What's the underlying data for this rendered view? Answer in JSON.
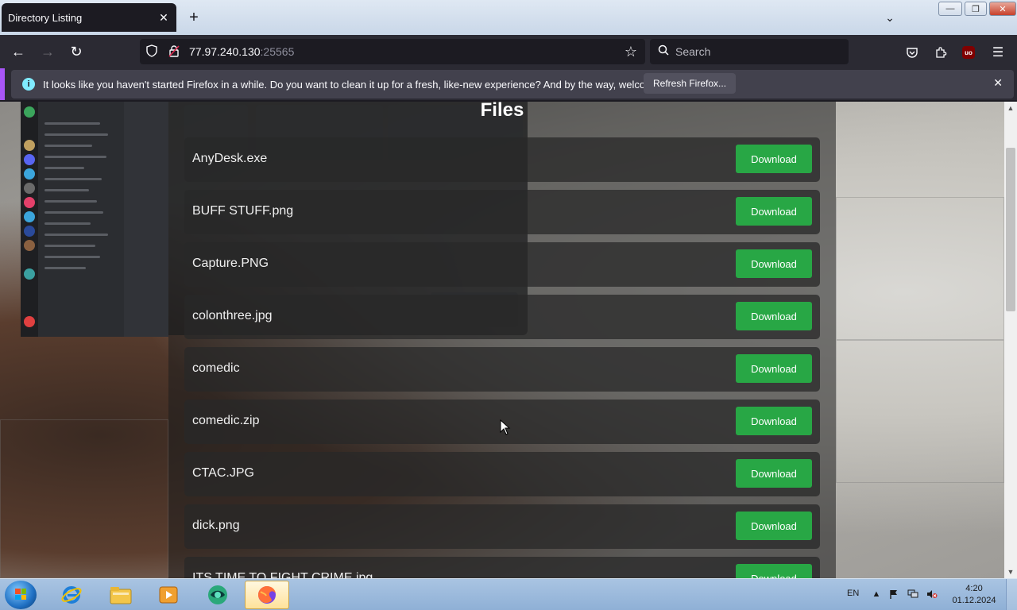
{
  "browser": {
    "tab": {
      "title": "Directory Listing",
      "close_glyph": "✕"
    },
    "new_tab_glyph": "+",
    "tab_list_glyph": "⌄",
    "window_controls": {
      "minimize": "—",
      "maximize": "❐",
      "close": "✕"
    },
    "nav": {
      "back": "←",
      "forward": "→",
      "reload": "↻"
    },
    "url": {
      "host": "77.97.240.130",
      "port": ":25565"
    },
    "search": {
      "placeholder": "Search"
    },
    "toolbar_icons": [
      "pocket-icon",
      "extensions-icon",
      "ublock-icon",
      "menu-icon"
    ],
    "ublock_label": "uo"
  },
  "notification": {
    "text": "It looks like you haven't started Firefox in a while. Do you want to clean it up for a fresh, like-new experience? And by the way, welcome back!",
    "button": "Refresh Firefox...",
    "close_glyph": "✕"
  },
  "page": {
    "title": "Files",
    "download_label": "Download",
    "files": [
      {
        "name": "AnyDesk.exe"
      },
      {
        "name": "BUFF STUFF.png"
      },
      {
        "name": "Capture.PNG"
      },
      {
        "name": "colonthree.jpg"
      },
      {
        "name": "comedic"
      },
      {
        "name": "comedic.zip"
      },
      {
        "name": "CTAC.JPG"
      },
      {
        "name": "dick.png"
      },
      {
        "name": "ITS TIME TO FIGHT CRIME.jpg"
      }
    ]
  },
  "taskbar": {
    "apps": [
      "internet-explorer-icon",
      "file-explorer-icon",
      "media-player-icon",
      "browser-app-icon",
      "firefox-icon"
    ],
    "language": "EN",
    "clock": {
      "time": "4:20",
      "date": "01.12.2024"
    }
  },
  "colors": {
    "accent": "#a855f7",
    "download_button": "#28a745",
    "chrome_dark": "#1c1b22",
    "toolbar": "#2b2a33"
  }
}
